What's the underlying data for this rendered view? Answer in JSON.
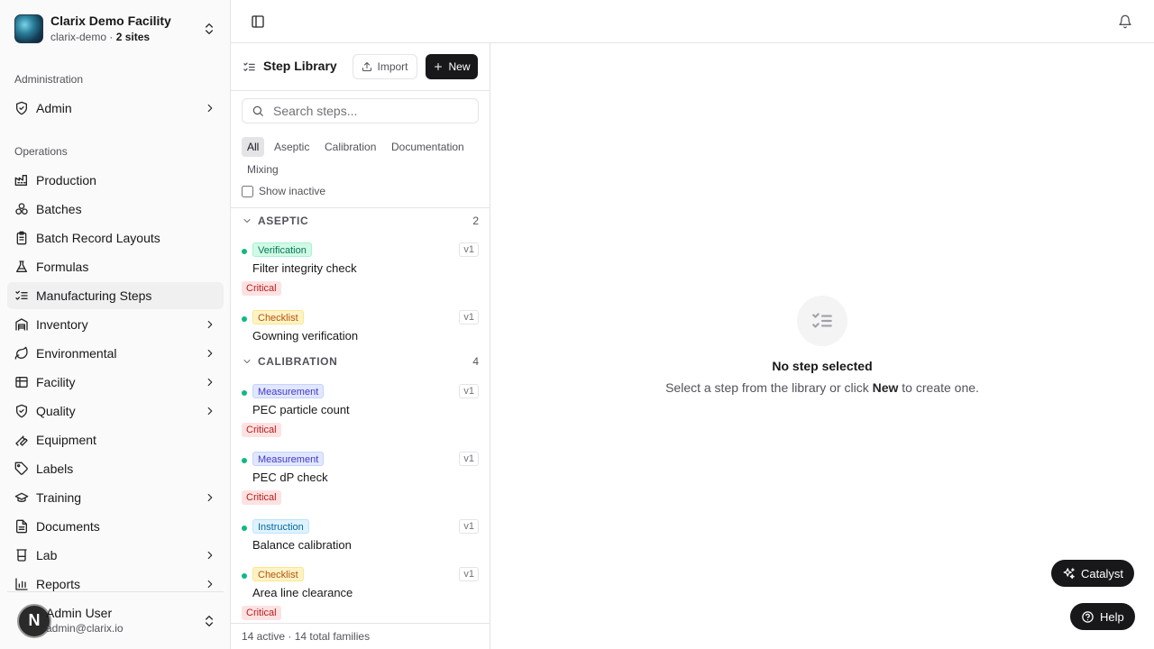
{
  "facility": {
    "name": "Clarix Demo Facility",
    "slug": "clarix-demo",
    "sites_sep": " · ",
    "sites": "2 sites"
  },
  "sidebar": {
    "admin_group": "Administration",
    "admin_item": "Admin",
    "ops_group": "Operations",
    "items": [
      {
        "label": "Production"
      },
      {
        "label": "Batches"
      },
      {
        "label": "Batch Record Layouts"
      },
      {
        "label": "Formulas"
      },
      {
        "label": "Manufacturing Steps"
      },
      {
        "label": "Inventory"
      },
      {
        "label": "Environmental"
      },
      {
        "label": "Facility"
      },
      {
        "label": "Quality"
      },
      {
        "label": "Equipment"
      },
      {
        "label": "Labels"
      },
      {
        "label": "Training"
      },
      {
        "label": "Documents"
      },
      {
        "label": "Lab"
      },
      {
        "label": "Reports"
      }
    ]
  },
  "user": {
    "initial": "N",
    "name": "Admin User",
    "email": "admin@clarix.io"
  },
  "library": {
    "title": "Step Library",
    "import_label": "Import",
    "new_label": "New",
    "search_placeholder": "Search steps...",
    "filters": [
      "All",
      "Aseptic",
      "Calibration",
      "Documentation",
      "Mixing"
    ],
    "show_inactive": "Show inactive",
    "categories": [
      {
        "name": "ASEPTIC",
        "count": "2",
        "steps": [
          {
            "type": "Verification",
            "name": "Filter integrity check",
            "version": "v1",
            "critical": "Critical"
          },
          {
            "type": "Checklist",
            "name": "Gowning verification",
            "version": "v1"
          }
        ]
      },
      {
        "name": "CALIBRATION",
        "count": "4",
        "steps": [
          {
            "type": "Measurement",
            "name": "PEC particle count",
            "version": "v1",
            "critical": "Critical"
          },
          {
            "type": "Measurement",
            "name": "PEC dP check",
            "version": "v1",
            "critical": "Critical"
          },
          {
            "type": "Instruction",
            "name": "Balance calibration",
            "version": "v1"
          },
          {
            "type": "Checklist",
            "name": "Area line clearance",
            "version": "v1",
            "critical": "Critical"
          }
        ]
      }
    ],
    "footer": "14 active · 14 total families"
  },
  "empty": {
    "title": "No step selected",
    "sub_before": "Select a step from the library or click ",
    "sub_bold": "New",
    "sub_after": " to create one."
  },
  "fabs": {
    "catalyst": "Catalyst",
    "help": "Help"
  }
}
